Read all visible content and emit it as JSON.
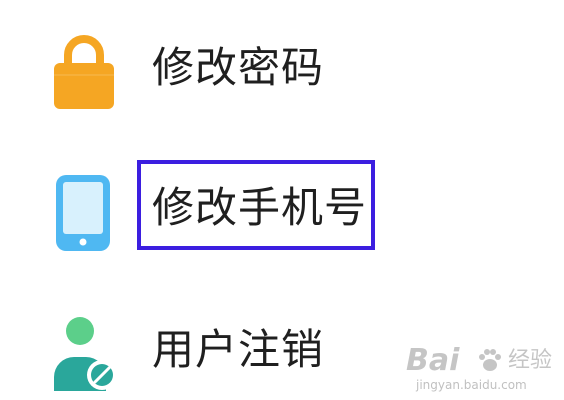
{
  "colors": {
    "background": "#ffffff",
    "text": "#1f1f1f",
    "highlight_border": "#3b1ee0",
    "lock_body": "#f5a623",
    "phone_body": "#4fb8f2",
    "user_green": "#5ccf8a",
    "user_teal": "#2aa79b"
  },
  "menu": {
    "items": [
      {
        "label": "修改密码",
        "icon": "lock-icon"
      },
      {
        "label": "修改手机号",
        "icon": "phone-icon"
      },
      {
        "label": "用户注销",
        "icon": "user-cancel-icon"
      }
    ]
  },
  "watermark": {
    "brand_left": "Bai",
    "brand_right": "经验",
    "url": "jingyan.baidu.com"
  }
}
